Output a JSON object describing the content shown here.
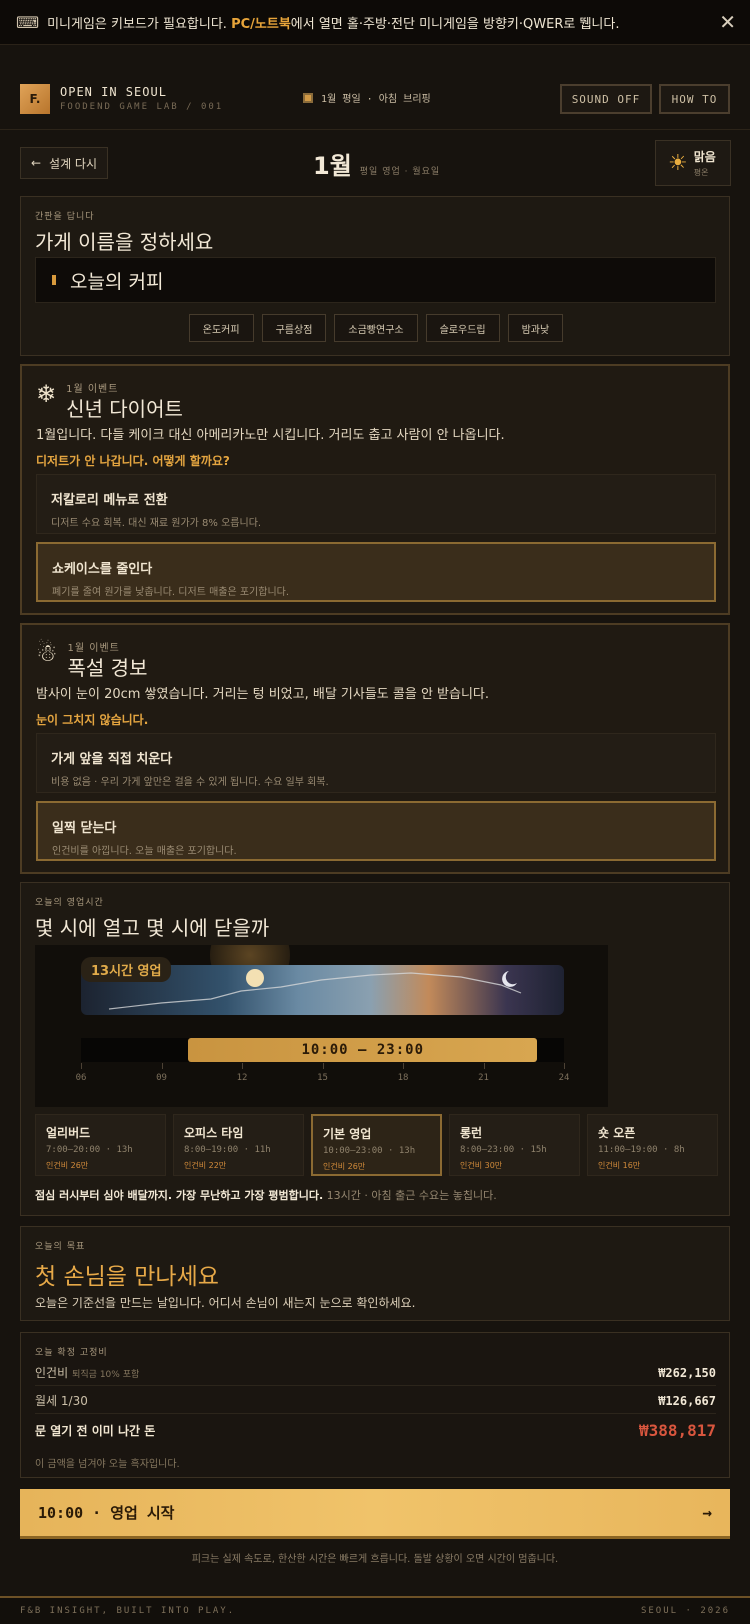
{
  "banner": {
    "icon": "keyboard-icon",
    "pre": "미니게임은 키보드가 필요합니다. ",
    "highlight": "PC/노트북",
    "post": "에서 열면 홀·주방·전단 미니게임을 방향키·QWER로 뛥니다."
  },
  "header": {
    "logo": "F.",
    "title": "OPEN IN SEOUL",
    "subtitle": "FOODEND GAME LAB / 001",
    "briefing": "1월 평일 · 아침 브리핑",
    "sound": "SOUND OFF",
    "howto": "HOW TO"
  },
  "daybar": {
    "back": "설계 다시",
    "month": "1월",
    "meta": "평일 영업 · 월요일",
    "weather": "맑음",
    "weather_sub": "평온"
  },
  "sign": {
    "eyebrow": "간판을 답니다",
    "title": "가게 이름을 정하세요",
    "value": "오늘의 커피",
    "chips": [
      "온도커피",
      "구름상점",
      "소금빵연구소",
      "슬로우드립",
      "밤과낮"
    ]
  },
  "events": [
    {
      "icon": "snowflake-icon",
      "label": "1월 이벤트",
      "title": "신년 다이어트",
      "desc": "1월입니다. 다들 케이크 대신 아메리카노만 시킵니다. 거리도 춥고 사람이 안 나옵니다.",
      "question": "디저트가 안 나갑니다. 어떻게 할까요?",
      "options": [
        {
          "title": "저칼로리 메뉴로 전환",
          "desc": "디저트 수요 회복. 대신 재료 원가가 8% 오릅니다.",
          "selected": false
        },
        {
          "title": "쇼케이스를 줄인다",
          "desc": "폐기를 줄여 원가를 낮춥니다. 디저트 매출은 포기합니다.",
          "selected": true
        }
      ]
    },
    {
      "icon": "snowman-icon",
      "label": "1월 이벤트",
      "title": "폭설 경보",
      "desc": "밤사이 눈이 20cm 쌓였습니다. 거리는 텅 비었고, 배달 기사들도 콜을 안 받습니다.",
      "question": "눈이 그치지 않습니다.",
      "options": [
        {
          "title": "가게 앞을 직접 치운다",
          "desc": "비용 없음 · 우리 가게 앞만은 걸을 수 있게 됩니다. 수요 일부 회복.",
          "selected": false
        },
        {
          "title": "일찍 닫는다",
          "desc": "인건비를 아낍니다. 오늘 매출은 포기합니다.",
          "selected": true
        }
      ]
    }
  ],
  "hours": {
    "eyebrow": "오늘의 영업시간",
    "title": "몇 시에 열고 몇 시에 닫을까",
    "badge": "13시간 영업",
    "range_label": "10:00 — 23:00",
    "open_hour": 10,
    "close_hour": 23,
    "axis_min": 6,
    "axis_max": 24,
    "ticks": [
      "06",
      "09",
      "12",
      "15",
      "18",
      "21",
      "24"
    ],
    "presets": [
      {
        "name": "얼리버드",
        "time": "7:00—20:00 · 13h",
        "cost": "인건비 26만",
        "selected": false
      },
      {
        "name": "오피스 타임",
        "time": "8:00—19:00 · 11h",
        "cost": "인건비 22만",
        "selected": false
      },
      {
        "name": "기본 영업",
        "time": "10:00—23:00 · 13h",
        "cost": "인건비 26만",
        "selected": true
      },
      {
        "name": "롱런",
        "time": "8:00—23:00 · 15h",
        "cost": "인건비 30만",
        "selected": false
      },
      {
        "name": "숏 오픈",
        "time": "11:00—19:00 · 8h",
        "cost": "인건비 16만",
        "selected": false
      }
    ],
    "note_bold": "점심 러시부터 심야 배달까지. 가장 무난하고 가장 평범합니다.",
    "note_rest": " 13시간 · 아침 출근 수요는 놓칩니다."
  },
  "goal": {
    "eyebrow": "오늘의 목표",
    "title": "첫 손님을 만나세요",
    "desc": "오늘은 기준선을 만드는 날입니다. 어디서 손님이 새는지 눈으로 확인하세요."
  },
  "costs": {
    "eyebrow": "오늘 확정 고정비",
    "labor_label": "인건비",
    "labor_note": "퇴직금 10% 포함",
    "labor_value": "₩262,150",
    "rent_label": "월세 1/30",
    "rent_value": "₩126,667",
    "total_label": "문 열기 전 이미 나간 돈",
    "total_value": "₩388,817",
    "note": "이 금액을 넘겨야 오늘 흑자입니다."
  },
  "start": {
    "label": "10:00 · 영업 시작",
    "note": "피크는 실제 속도로, 한산한 시간은 빠르게 흐릅니다. 돌발 상황이 오면 시간이 멈춥니다."
  },
  "footer": {
    "left": "F&B INSIGHT, BUILT INTO PLAY.",
    "right": "SEOUL · 2026"
  },
  "colors": {
    "accent": "#e4a540",
    "background": "#17130e",
    "danger": "#d9563e"
  }
}
